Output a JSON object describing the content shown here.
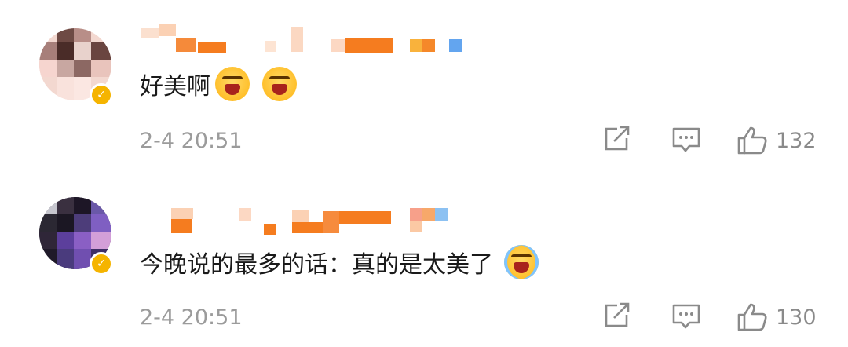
{
  "comments": [
    {
      "text": "好美啊",
      "emoji": [
        "laughing-emoji",
        "laughing-emoji"
      ],
      "time": "2-4 20:51",
      "likes": "132"
    },
    {
      "text": "今晚说的最多的话：真的是太美了",
      "emoji": [
        "laugh-cry-emoji"
      ],
      "time": "2-4 20:51",
      "likes": "130"
    }
  ],
  "colors": {
    "name_orange": "#f57c1f",
    "name_light": "#fbd1b4",
    "time_gray": "#9b9b9b",
    "icon_gray": "#8a8a8a",
    "verified_badge": "#f5b400"
  },
  "icons": [
    "share-icon",
    "comment-icon",
    "like-icon",
    "verified-badge-icon"
  ]
}
